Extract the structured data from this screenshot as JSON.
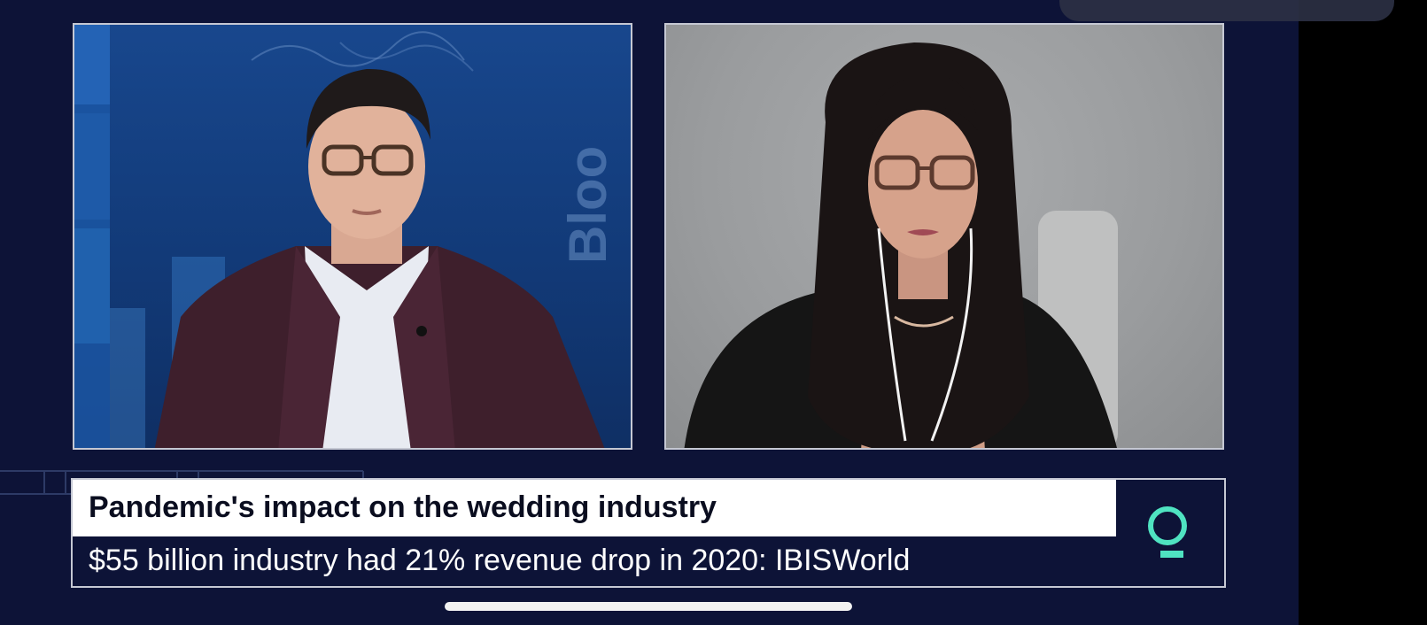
{
  "lower_third": {
    "headline": "Pandemic's impact on the wedding industry",
    "subhead": "$55 billion industry had 21% revenue drop in 2020: IBISWorld"
  },
  "logo": {
    "icon": "q-logo-icon",
    "color": "#4fe3c1"
  },
  "colors": {
    "background": "#0d1337",
    "panel_border": "#c5c8d3",
    "headline_bg": "#ffffff",
    "headline_text": "#0a0d1f",
    "subhead_text": "#ffffff"
  }
}
